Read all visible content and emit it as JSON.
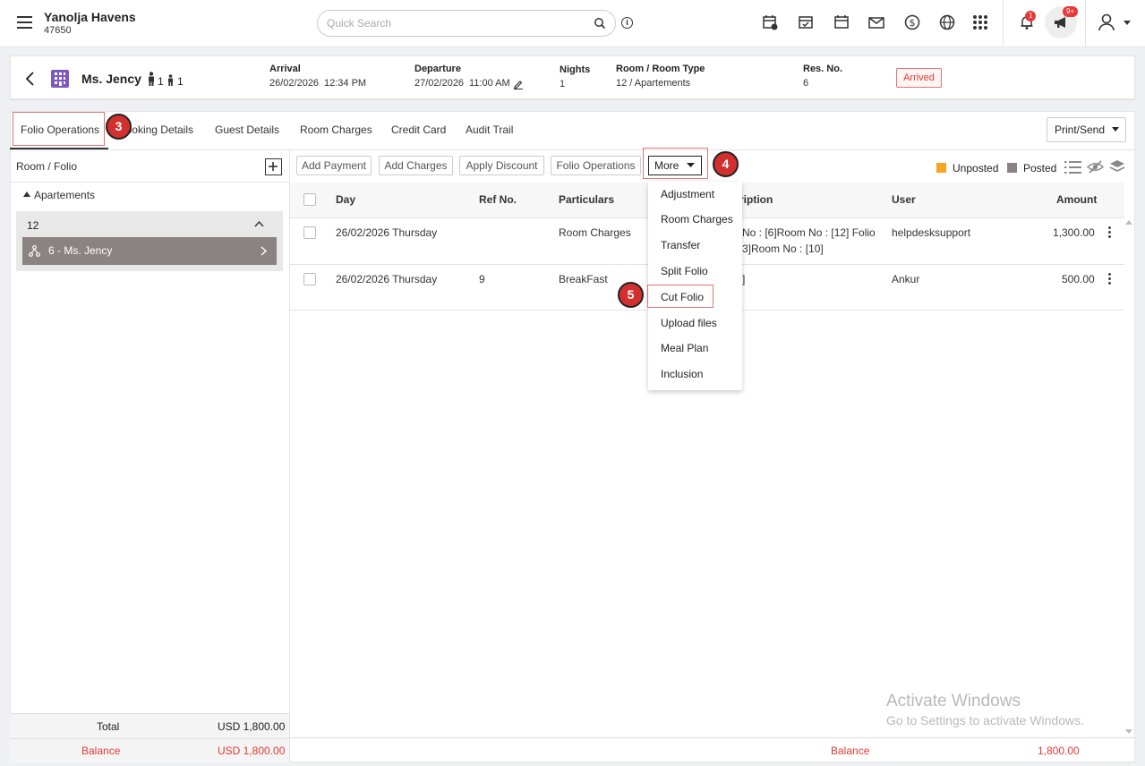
{
  "header": {
    "hotel_name": "Yanolja Havens",
    "hotel_code": "47650",
    "search_placeholder": "Quick Search",
    "notification_count": "1",
    "announcement_count": "9+"
  },
  "guest": {
    "name": "Ms. Jency",
    "adults": "1",
    "children": "1",
    "arrival_label": "Arrival",
    "arrival_date": "26/02/2026",
    "arrival_time": "12:34 PM",
    "departure_label": "Departure",
    "departure_date": "27/02/2026",
    "departure_time": "11:00 AM",
    "nights_label": "Nights",
    "nights": "1",
    "room_label": "Room / Room Type",
    "room_value": "12 / Apartements",
    "resno_label": "Res. No.",
    "resno": "6",
    "status": "Arrived"
  },
  "tabs": [
    {
      "label": "Folio Operations"
    },
    {
      "label": "Booking Details"
    },
    {
      "label": "Guest Details"
    },
    {
      "label": "Room Charges"
    },
    {
      "label": "Credit Card"
    },
    {
      "label": "Audit Trail"
    }
  ],
  "print_send": "Print/Send",
  "steps": {
    "s3": "3",
    "s4": "4",
    "s5": "5"
  },
  "left": {
    "title": "Room / Folio",
    "group": "Apartements",
    "room": "12",
    "folio": "6 - Ms. Jency",
    "total_label": "Total",
    "total_value": "USD 1,800.00",
    "balance_label": "Balance",
    "balance_value": "USD 1,800.00"
  },
  "toolbar": {
    "add_payment": "Add Payment",
    "add_charges": "Add Charges",
    "apply_discount": "Apply Discount",
    "folio_operations": "Folio Operations",
    "more": "More",
    "unposted": "Unposted",
    "posted": "Posted"
  },
  "colors": {
    "unposted": "#f5a623",
    "posted": "#8b8282",
    "accent": "#d32f2f"
  },
  "table": {
    "headers": {
      "day": "Day",
      "ref": "Ref No.",
      "particulars": "Particulars",
      "description": "ription",
      "user": "User",
      "amount": "Amount"
    },
    "rows": [
      {
        "day": "26/02/2026 Thursday",
        "ref": "",
        "particulars": "Room Charges",
        "desc1": "No : [6]Room No : [12] Folio",
        "desc2": "3]Room No : [10]",
        "user": "helpdesksupport",
        "amount": "1,300.00"
      },
      {
        "day": "26/02/2026 Thursday",
        "ref": "9",
        "particulars": "BreakFast",
        "desc1": "]",
        "desc2": "",
        "user": "Ankur",
        "amount": "500.00"
      }
    ]
  },
  "dropdown": [
    "Adjustment",
    "Room Charges",
    "Transfer",
    "Split Folio",
    "Cut Folio",
    "Upload files",
    "Meal Plan",
    "Inclusion"
  ],
  "footer": {
    "balance_label": "Balance",
    "balance_value": "1,800.00"
  },
  "watermark": {
    "line1": "Activate Windows",
    "line2": "Go to Settings to activate Windows."
  }
}
